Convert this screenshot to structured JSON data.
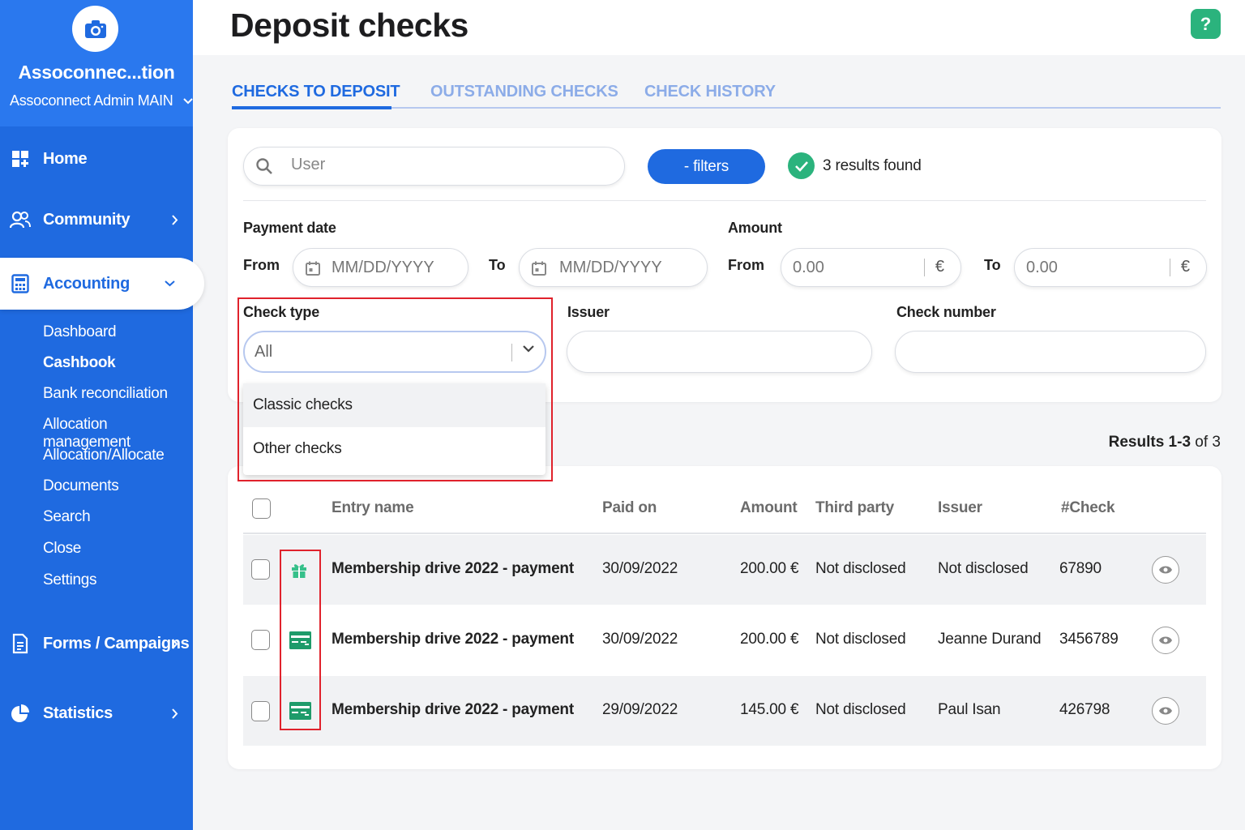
{
  "sidebar": {
    "org_name": "Assoconnec...tion",
    "org_sub": "Assoconnect Admin MAIN",
    "nav": {
      "home": "Home",
      "community": "Community",
      "accounting": "Accounting",
      "forms": "Forms / Campaigns",
      "statistics": "Statistics"
    },
    "accounting_items": [
      "Dashboard",
      "Cashbook",
      "Bank reconciliation",
      "Allocation management",
      "Allocation/Allocate",
      "Documents",
      "Search",
      "Close",
      "Settings"
    ]
  },
  "header": {
    "title": "Deposit checks",
    "help_label": "?"
  },
  "tabs": [
    "CHECKS TO DEPOSIT",
    "OUTSTANDING CHECKS",
    "CHECK HISTORY"
  ],
  "filters": {
    "search_placeholder": "User",
    "filters_button": "- filters",
    "results_found": "3 results found",
    "payment_date_label": "Payment date",
    "from_label": "From",
    "to_label": "To",
    "date_placeholder": "MM/DD/YYYY",
    "amount_label": "Amount",
    "amount_placeholder": "0.00",
    "currency": "€",
    "check_type_label": "Check type",
    "check_type_value": "All",
    "check_type_options": [
      "Classic checks",
      "Other checks"
    ],
    "issuer_label": "Issuer",
    "check_number_label": "Check number"
  },
  "results_range": {
    "prefix": "Results 1-3",
    "suffix": " of 3"
  },
  "table": {
    "headers": [
      "Entry name",
      "Paid on",
      "Amount",
      "Third party",
      "Issuer",
      "#Check"
    ],
    "rows": [
      {
        "type_icon": "gift-icon",
        "entry": "Membership drive 2022 - payment",
        "paid_on": "30/09/2022",
        "amount": "200.00 €",
        "third_party": "Not disclosed",
        "issuer": "Not disclosed",
        "check": "67890"
      },
      {
        "type_icon": "check-card-icon",
        "entry": "Membership drive 2022 - payment",
        "paid_on": "30/09/2022",
        "amount": "200.00 €",
        "third_party": "Not disclosed",
        "issuer": "Jeanne Durand",
        "check": "3456789"
      },
      {
        "type_icon": "check-card-icon",
        "entry": "Membership drive 2022 - payment",
        "paid_on": "29/09/2022",
        "amount": "145.00 €",
        "third_party": "Not disclosed",
        "issuer": "Paul Isan",
        "check": "426798"
      }
    ]
  },
  "colors": {
    "primary": "#1f6ae0",
    "success": "#2bb37d",
    "highlight": "#e0222c"
  }
}
